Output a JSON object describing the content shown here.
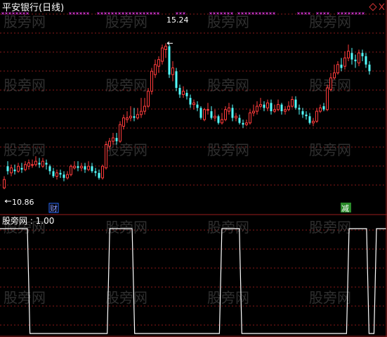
{
  "colors": {
    "background": "#000000",
    "up": "#ff3b3b",
    "down": "#54ffff",
    "grid": "#8a1a1a",
    "panel_border": "#9a1c1c",
    "signal_line": "#ffffff",
    "marker": "#cc33cc",
    "text": "#ffffff",
    "flag_text": "#8899ff",
    "flag_box": "#2b6bff",
    "flag2_text": "#ffffff",
    "flag2_box": "#2a8a2a",
    "watermark": "#555555"
  },
  "header": {
    "title": "平安银行(日线)",
    "corner_icons": [
      "diamond-icon",
      "close-icon"
    ]
  },
  "price_panel": {
    "high_label": "15.24",
    "low_label": "10.86",
    "flag_left": "财",
    "flag_right": "减"
  },
  "indicator_panel": {
    "label": "股旁网 : 1.00"
  },
  "watermark": "股旁网",
  "chart_data": [
    {
      "type": "candlestick",
      "title": "平安银行(日线)",
      "ylim": [
        10.5,
        16.2
      ],
      "annotations": [
        {
          "text": "15.24",
          "candle_index": 46,
          "kind": "max"
        },
        {
          "text": "10.86",
          "candle_index": 0,
          "kind": "min"
        }
      ],
      "candles": [
        [
          10.9,
          11.15,
          11.25,
          10.86
        ],
        [
          11.55,
          11.4,
          11.7,
          11.3
        ],
        [
          11.35,
          11.5,
          11.6,
          11.25
        ],
        [
          11.45,
          11.4,
          11.6,
          11.3
        ],
        [
          11.4,
          11.55,
          11.65,
          11.35
        ],
        [
          11.5,
          11.45,
          11.65,
          11.35
        ],
        [
          11.45,
          11.6,
          11.7,
          11.4
        ],
        [
          11.55,
          11.65,
          11.75,
          11.45
        ],
        [
          11.6,
          11.6,
          11.75,
          11.5
        ],
        [
          11.6,
          11.7,
          11.85,
          11.55
        ],
        [
          11.65,
          11.6,
          11.8,
          11.5
        ],
        [
          11.55,
          11.7,
          11.8,
          11.5
        ],
        [
          11.65,
          11.6,
          11.75,
          11.45
        ],
        [
          11.55,
          11.4,
          11.6,
          11.3
        ],
        [
          11.4,
          11.25,
          11.5,
          11.2
        ],
        [
          11.25,
          11.35,
          11.45,
          11.15
        ],
        [
          11.35,
          11.3,
          11.45,
          11.2
        ],
        [
          11.3,
          11.2,
          11.4,
          11.1
        ],
        [
          11.2,
          11.3,
          11.4,
          11.15
        ],
        [
          11.3,
          11.55,
          11.6,
          11.25
        ],
        [
          11.5,
          11.55,
          11.7,
          11.45
        ],
        [
          11.55,
          11.5,
          11.7,
          11.4
        ],
        [
          11.5,
          11.55,
          11.65,
          11.4
        ],
        [
          11.55,
          11.45,
          11.65,
          11.35
        ],
        [
          11.45,
          11.55,
          11.7,
          11.4
        ],
        [
          11.55,
          11.4,
          11.65,
          11.35
        ],
        [
          11.4,
          11.35,
          11.5,
          11.25
        ],
        [
          11.35,
          11.2,
          11.45,
          11.15
        ],
        [
          11.2,
          11.55,
          11.6,
          11.15
        ],
        [
          11.5,
          12.2,
          12.3,
          11.45
        ],
        [
          12.15,
          12.3,
          12.4,
          12.05
        ],
        [
          12.3,
          12.4,
          12.55,
          12.2
        ],
        [
          12.4,
          12.3,
          12.55,
          12.2
        ],
        [
          12.3,
          12.8,
          12.9,
          12.25
        ],
        [
          12.75,
          13.0,
          13.1,
          12.65
        ],
        [
          12.95,
          13.0,
          13.2,
          12.85
        ],
        [
          13.0,
          13.05,
          13.35,
          12.9
        ],
        [
          13.05,
          13.0,
          13.3,
          12.9
        ],
        [
          13.0,
          13.1,
          13.3,
          12.95
        ],
        [
          13.1,
          13.2,
          13.6,
          13.0
        ],
        [
          13.2,
          13.35,
          13.6,
          13.1
        ],
        [
          13.35,
          13.8,
          13.9,
          13.3
        ],
        [
          13.8,
          14.4,
          14.5,
          13.7
        ],
        [
          14.3,
          14.6,
          14.75,
          14.2
        ],
        [
          14.55,
          14.75,
          14.85,
          14.35
        ],
        [
          14.7,
          15.1,
          15.2,
          14.6
        ],
        [
          15.05,
          15.15,
          15.24,
          14.8
        ],
        [
          15.15,
          14.3,
          15.2,
          14.2
        ],
        [
          14.3,
          14.5,
          14.7,
          14.1
        ],
        [
          14.4,
          13.9,
          14.5,
          13.8
        ],
        [
          13.9,
          13.7,
          14.0,
          13.6
        ],
        [
          13.7,
          13.8,
          13.95,
          13.6
        ],
        [
          13.75,
          13.65,
          13.85,
          13.55
        ],
        [
          13.6,
          13.4,
          13.7,
          13.3
        ],
        [
          13.4,
          13.45,
          13.55,
          13.25
        ],
        [
          13.4,
          13.3,
          13.5,
          13.2
        ],
        [
          13.3,
          13.0,
          13.35,
          12.95
        ],
        [
          12.95,
          13.25,
          13.3,
          12.9
        ],
        [
          13.25,
          13.25,
          13.45,
          13.1
        ],
        [
          13.2,
          13.0,
          13.35,
          12.95
        ],
        [
          13.0,
          13.05,
          13.25,
          12.9
        ],
        [
          13.05,
          12.85,
          13.1,
          12.8
        ],
        [
          12.85,
          12.95,
          13.15,
          12.8
        ],
        [
          12.95,
          13.25,
          13.35,
          12.9
        ],
        [
          13.2,
          13.3,
          13.45,
          13.1
        ],
        [
          13.3,
          13.0,
          13.4,
          12.9
        ],
        [
          13.0,
          13.05,
          13.15,
          12.9
        ],
        [
          13.0,
          12.85,
          13.1,
          12.8
        ],
        [
          12.85,
          12.8,
          12.95,
          12.7
        ],
        [
          12.8,
          12.85,
          12.95,
          12.75
        ],
        [
          12.85,
          13.15,
          13.25,
          12.8
        ],
        [
          13.15,
          13.2,
          13.4,
          13.05
        ],
        [
          13.2,
          13.35,
          13.5,
          13.1
        ],
        [
          13.35,
          13.4,
          13.6,
          13.3
        ],
        [
          13.4,
          13.3,
          13.5,
          13.2
        ],
        [
          13.3,
          13.45,
          13.55,
          13.2
        ],
        [
          13.45,
          13.2,
          13.55,
          13.1
        ],
        [
          13.2,
          13.25,
          13.4,
          13.15
        ],
        [
          13.25,
          13.4,
          13.55,
          13.2
        ],
        [
          13.4,
          13.2,
          13.45,
          13.1
        ],
        [
          13.2,
          13.25,
          13.35,
          13.1
        ],
        [
          13.25,
          13.35,
          13.5,
          13.2
        ],
        [
          13.35,
          13.55,
          13.65,
          13.3
        ],
        [
          13.55,
          13.3,
          13.65,
          13.25
        ],
        [
          13.3,
          13.25,
          13.4,
          13.1
        ],
        [
          13.2,
          13.1,
          13.3,
          13.0
        ],
        [
          13.1,
          13.05,
          13.2,
          12.95
        ],
        [
          13.05,
          12.85,
          13.15,
          12.8
        ],
        [
          12.85,
          12.9,
          13.0,
          12.75
        ],
        [
          12.9,
          13.2,
          13.3,
          12.85
        ],
        [
          13.2,
          13.3,
          13.4,
          13.15
        ],
        [
          13.35,
          13.25,
          13.45,
          13.2
        ],
        [
          13.25,
          13.9,
          14.0,
          13.2
        ],
        [
          13.85,
          14.2,
          14.35,
          13.8
        ],
        [
          14.2,
          14.35,
          14.6,
          14.15
        ],
        [
          14.35,
          14.6,
          14.7,
          14.3
        ],
        [
          14.6,
          14.5,
          14.8,
          14.4
        ],
        [
          14.55,
          14.8,
          15.0,
          14.45
        ],
        [
          14.8,
          15.0,
          15.2,
          14.7
        ],
        [
          14.95,
          14.75,
          15.1,
          14.6
        ],
        [
          14.75,
          14.7,
          14.9,
          14.5
        ],
        [
          14.65,
          14.95,
          15.05,
          14.55
        ],
        [
          14.95,
          14.85,
          15.05,
          14.7
        ],
        [
          14.85,
          14.6,
          14.95,
          14.5
        ],
        [
          14.6,
          14.4,
          14.7,
          14.3
        ]
      ]
    },
    {
      "type": "line",
      "title": "股旁网",
      "ylim": [
        0,
        1
      ],
      "series": [
        {
          "name": "股旁网",
          "values": [
            1,
            1,
            1,
            1,
            1,
            1,
            1,
            1,
            1,
            1,
            1,
            1,
            0,
            0,
            0,
            0,
            0,
            0,
            0,
            0,
            0,
            0,
            0,
            0,
            0,
            0,
            0,
            0,
            0,
            0,
            0,
            0,
            0,
            0,
            0,
            0,
            0,
            0,
            0,
            0,
            0,
            0,
            0,
            0,
            1,
            1,
            1,
            1,
            1,
            1,
            1,
            1,
            1,
            1,
            0,
            0,
            0,
            0,
            0,
            0,
            0,
            0,
            0,
            0,
            0,
            0,
            0,
            0,
            0,
            0,
            0,
            0,
            0,
            0,
            0,
            0,
            0,
            0,
            0,
            0,
            0,
            0,
            0,
            0,
            0,
            0,
            0,
            0,
            0,
            1,
            1,
            1,
            1,
            1,
            1,
            1,
            1,
            0,
            0,
            0,
            0,
            0,
            0,
            0,
            0,
            0,
            0,
            0,
            0,
            0,
            0,
            0,
            0,
            0,
            0,
            0,
            0,
            0,
            0,
            0,
            0,
            0,
            0,
            0,
            0,
            0,
            0,
            0,
            0,
            0,
            0,
            0,
            0,
            0,
            0,
            0,
            0,
            0,
            0,
            0,
            1,
            1,
            1,
            1,
            1,
            1,
            1,
            1,
            0,
            0,
            0,
            1,
            1,
            1,
            1,
            1
          ]
        }
      ]
    }
  ]
}
